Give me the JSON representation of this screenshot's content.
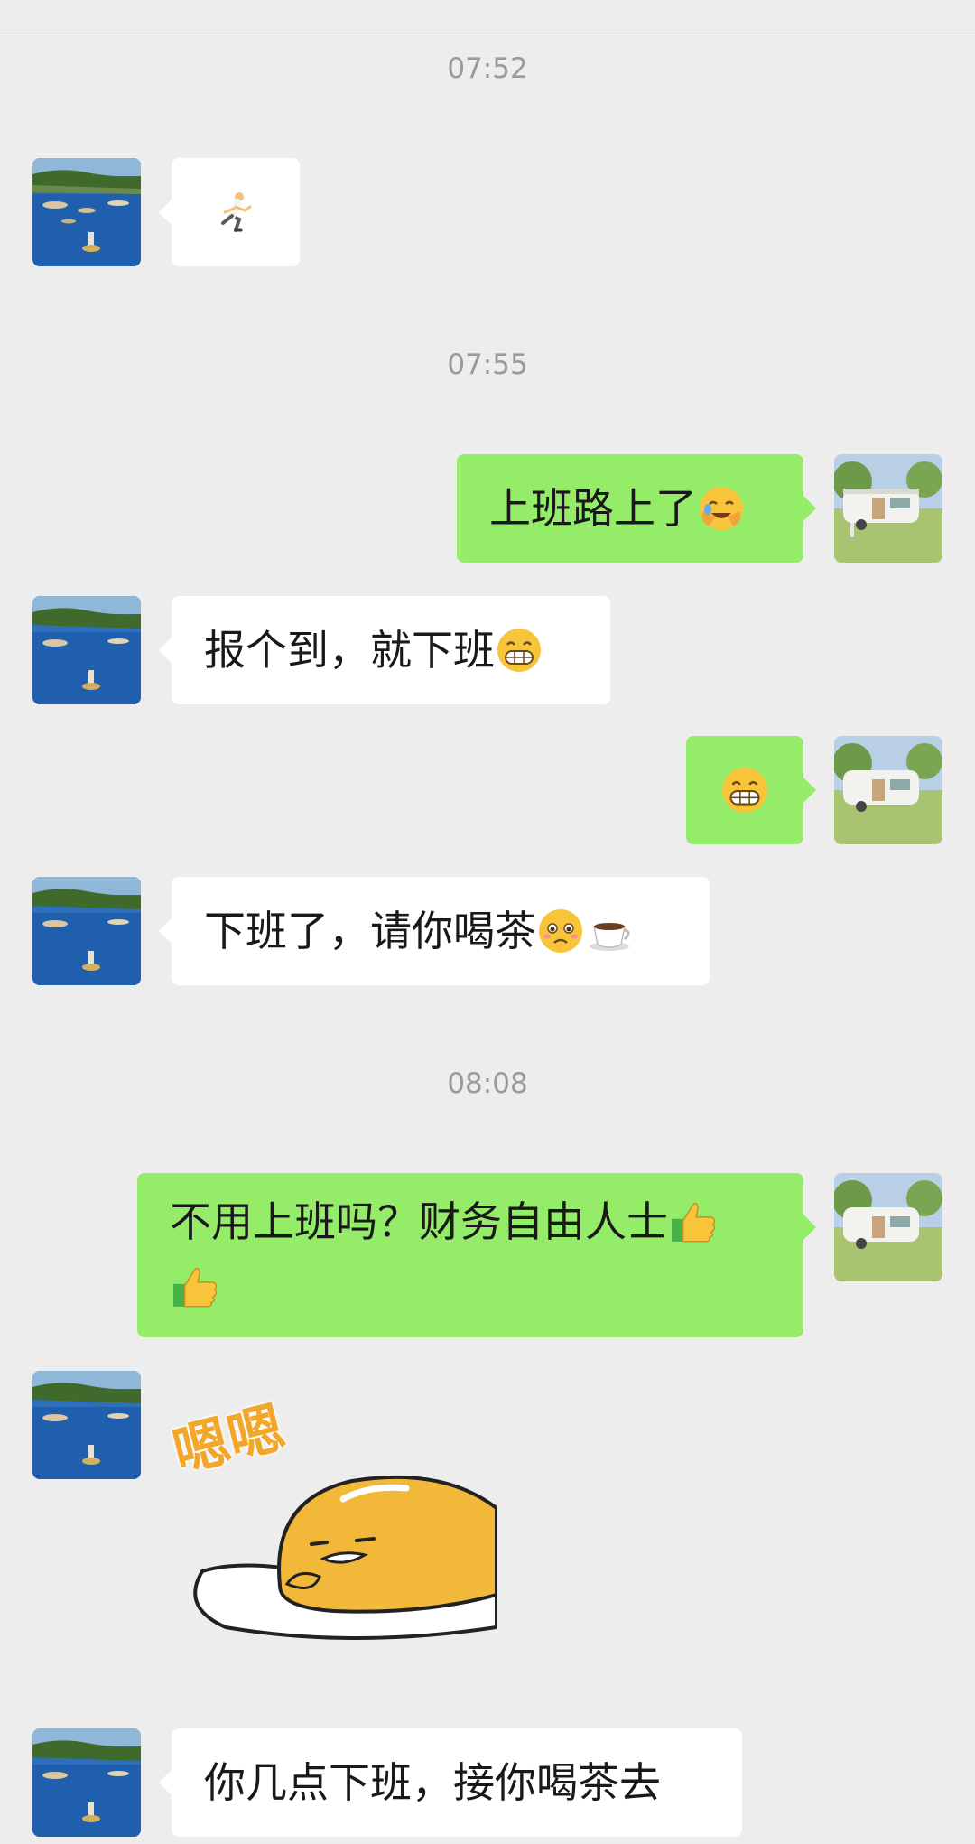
{
  "timestamps": [
    "07:52",
    "07:55",
    "08:08"
  ],
  "messages": [
    {
      "from": "them",
      "kind": "emoji",
      "emoji": "runner-emoji"
    },
    {
      "from": "me",
      "text": "上班路上了",
      "emoji": "facepalm-emoji"
    },
    {
      "from": "them",
      "text": "报个到，就下班",
      "emoji": "grin-emoji"
    },
    {
      "from": "me",
      "kind": "emoji",
      "emoji": "grin-emoji"
    },
    {
      "from": "them",
      "text": "下班了，请你喝茶",
      "emoji": [
        "pleading-emoji",
        "tea-emoji"
      ]
    },
    {
      "from": "me",
      "text_line1": "不用上班吗？财务自由人士",
      "emoji": [
        "thumbs-up-emoji",
        "thumbs-up-emoji"
      ]
    },
    {
      "from": "them",
      "kind": "sticker",
      "sticker_text": "嗯嗯",
      "sticker": "lazy-egg-sticker"
    },
    {
      "from": "them",
      "text": "你几点下班，接你喝茶去"
    }
  ],
  "colors": {
    "background": "#ededed",
    "outgoing_bubble": "#95ec69",
    "incoming_bubble": "#ffffff",
    "timestamp": "#9a9a9a"
  }
}
